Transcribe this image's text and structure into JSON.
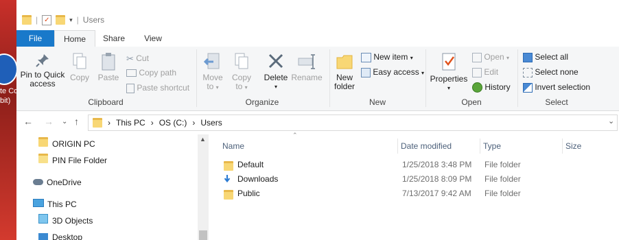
{
  "desktop": {
    "label_line1": "te Co",
    "label_line2": "bit)"
  },
  "title": "Users",
  "tabs": [
    "File",
    "Home",
    "Share",
    "View"
  ],
  "ribbon": {
    "clipboard": {
      "label": "Clipboard",
      "pin_line1": "Pin to Quick",
      "pin_line2": "access",
      "copy": "Copy",
      "paste": "Paste",
      "cut": "Cut",
      "copy_path": "Copy path",
      "paste_shortcut": "Paste shortcut"
    },
    "organize": {
      "label": "Organize",
      "move_to": "Move",
      "move_to_2": "to",
      "copy_to": "Copy",
      "copy_to_2": "to",
      "delete": "Delete",
      "rename": "Rename"
    },
    "new": {
      "label": "New",
      "new_folder_1": "New",
      "new_folder_2": "folder",
      "new_item": "New item",
      "easy_access": "Easy access"
    },
    "open": {
      "label": "Open",
      "properties": "Properties",
      "open": "Open",
      "edit": "Edit",
      "history": "History"
    },
    "select": {
      "label": "Select",
      "select_all": "Select all",
      "select_none": "Select none",
      "invert": "Invert selection"
    }
  },
  "address": {
    "crumbs": [
      "This PC",
      "OS (C:)",
      "Users"
    ]
  },
  "nav_pane": {
    "items": [
      "ORIGIN PC",
      "PIN File Folder",
      "OneDrive",
      "This PC",
      "3D Objects",
      "Desktop"
    ]
  },
  "columns": {
    "name": "Name",
    "date": "Date modified",
    "type": "Type",
    "size": "Size"
  },
  "files": [
    {
      "name": "Default",
      "date": "1/25/2018 3:48 PM",
      "type": "File folder",
      "icon": "folder-icon"
    },
    {
      "name": "Downloads",
      "date": "1/25/2018 8:09 PM",
      "type": "File folder",
      "icon": "download-icon"
    },
    {
      "name": "Public",
      "date": "7/13/2017 9:42 AM",
      "type": "File folder",
      "icon": "folder-icon"
    }
  ],
  "colors": {
    "accent": "#1979ca",
    "ribbon_bg": "#f5f6f7"
  }
}
